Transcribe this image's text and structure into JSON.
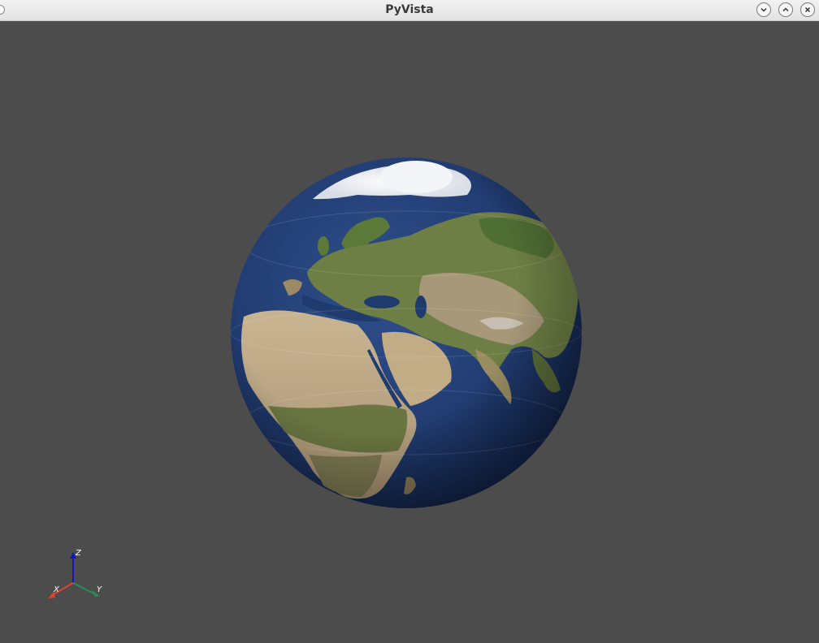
{
  "window": {
    "title": "PyVista",
    "controls": [
      "minimize",
      "maximize",
      "close"
    ]
  },
  "viewport": {
    "background": "#4c4c4c",
    "scene_object": "earth-globe"
  },
  "axes_widget": {
    "x_label": "X",
    "y_label": "Y",
    "z_label": "Z",
    "x_color": "#e0452b",
    "y_color": "#2e8b57",
    "z_color": "#1515c8"
  }
}
